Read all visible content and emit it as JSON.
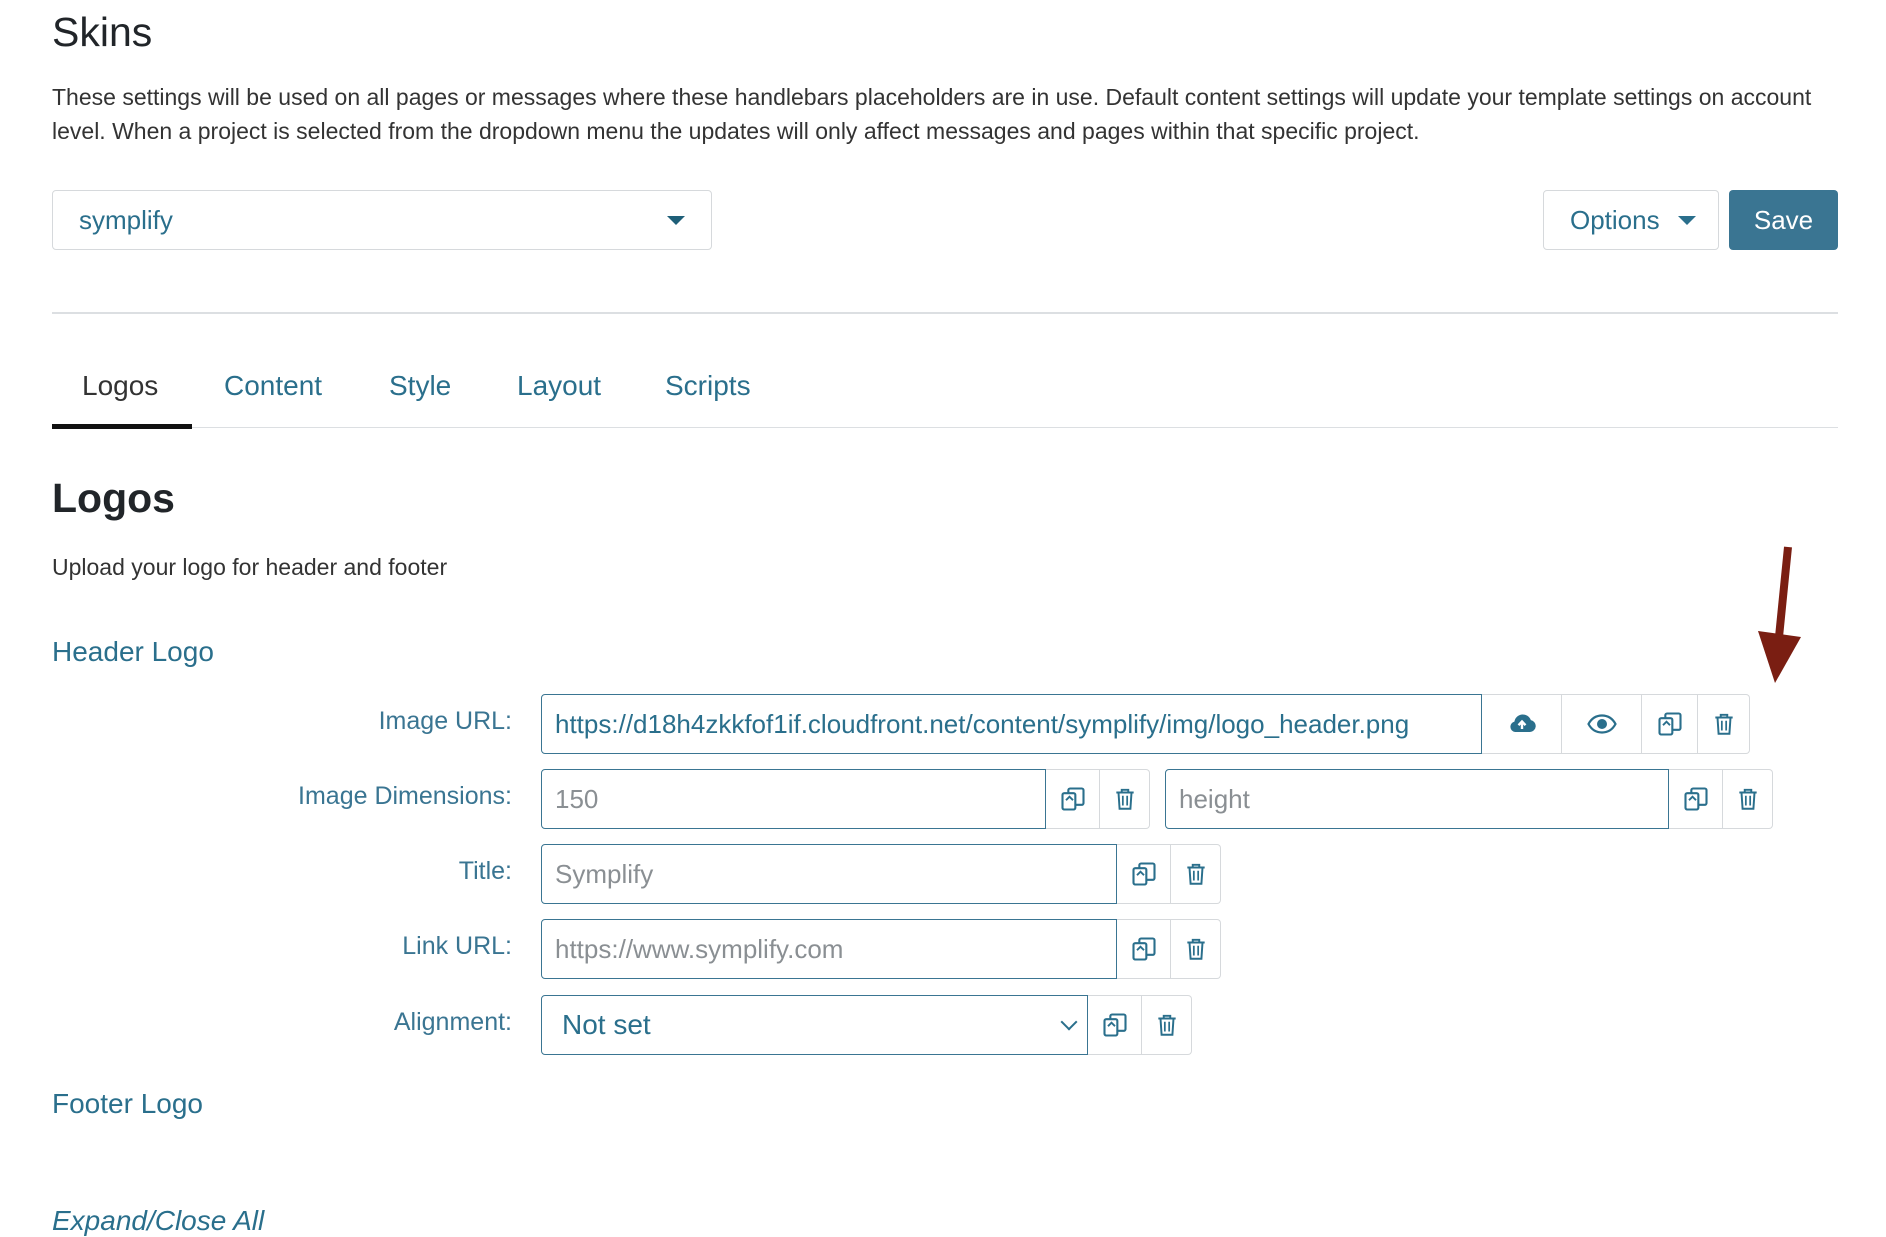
{
  "page": {
    "title": "Skins",
    "description": "These settings will be used on all pages or messages where these handlebars placeholders are in use. Default content settings will update your template settings on account level. When a project is selected from the dropdown menu the updates will only affect messages and pages within that specific project."
  },
  "toolbar": {
    "project_value": "symplify",
    "options_label": "Options",
    "save_label": "Save"
  },
  "tabs": [
    {
      "label": "Logos",
      "active": true
    },
    {
      "label": "Content",
      "active": false
    },
    {
      "label": "Style",
      "active": false
    },
    {
      "label": "Layout",
      "active": false
    },
    {
      "label": "Scripts",
      "active": false
    }
  ],
  "logos": {
    "title": "Logos",
    "description": "Upload your logo for header and footer",
    "header_title": "Header Logo",
    "footer_title": "Footer Logo",
    "expand_label": "Expand/Close All",
    "fields": {
      "image_url": {
        "label": "Image URL:",
        "value": "https://d18h4zkkfof1if.cloudfront.net/content/symplify/img/logo_header.png"
      },
      "dimensions": {
        "label": "Image Dimensions:",
        "width_placeholder": "150",
        "height_placeholder": "height"
      },
      "title": {
        "label": "Title:",
        "placeholder": "Symplify"
      },
      "link_url": {
        "label": "Link URL:",
        "placeholder": "https://www.symplify.com"
      },
      "alignment": {
        "label": "Alignment:",
        "value": "Not set"
      }
    }
  },
  "colors": {
    "accent": "#3a7592",
    "link": "#2a6f8c",
    "arrow": "#7a1e12"
  },
  "icons": [
    "upload-cloud-icon",
    "eye-icon",
    "copy-icon",
    "trash-icon",
    "caret-down-icon",
    "chevron-down-icon",
    "arrow-down-icon"
  ]
}
